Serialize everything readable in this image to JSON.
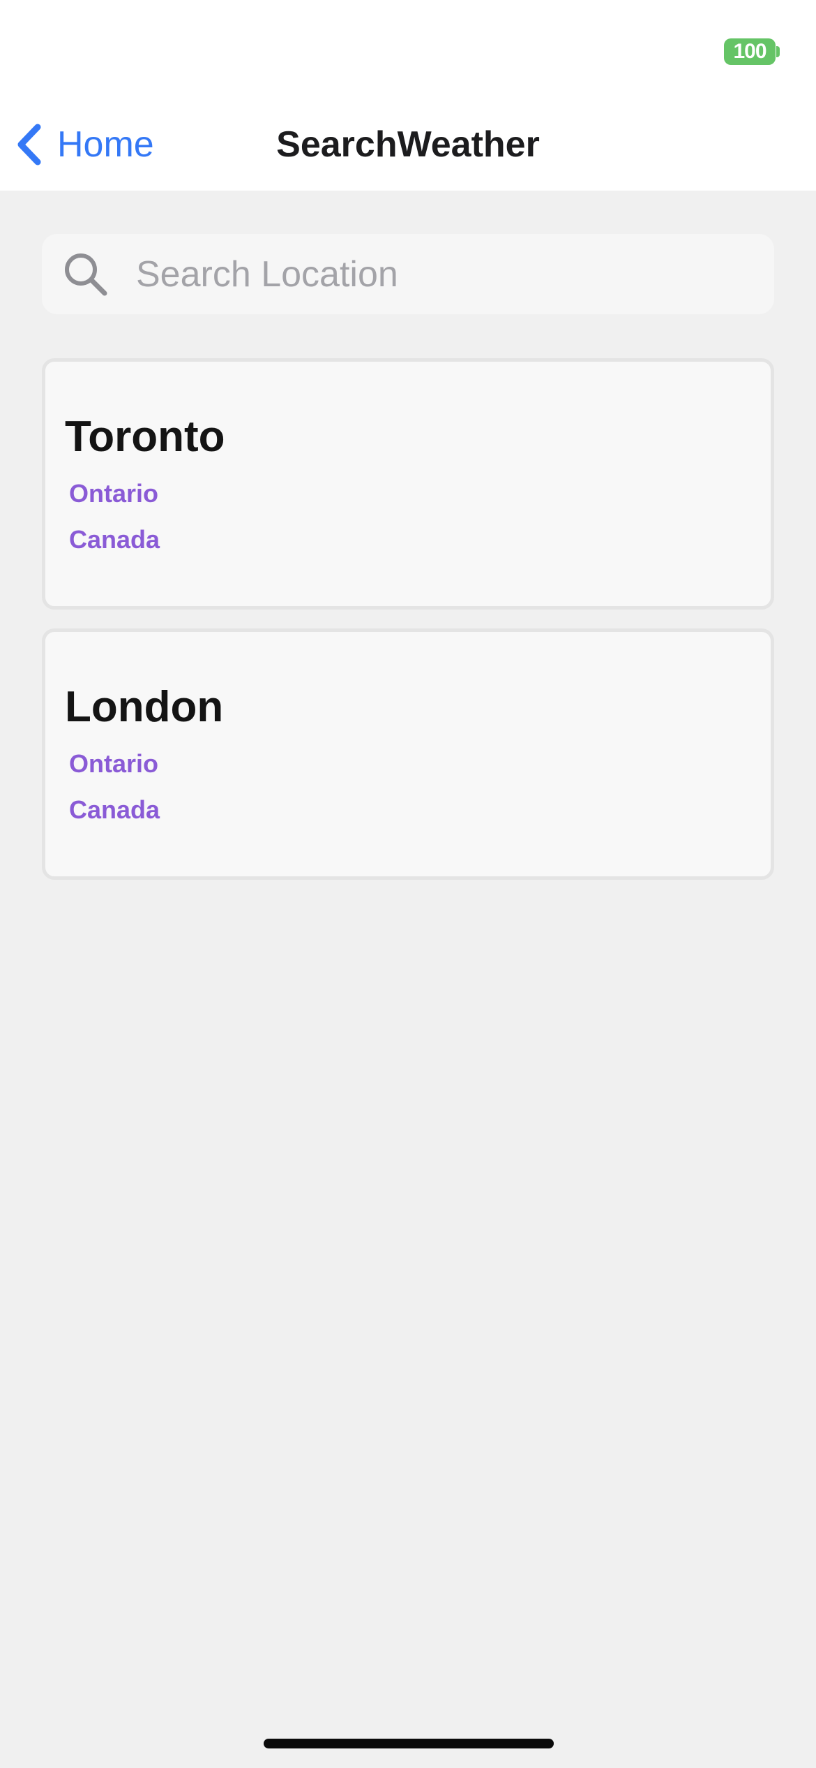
{
  "status_bar": {
    "battery_level": "100",
    "battery_color": "#65c466"
  },
  "nav": {
    "back_icon": "chevron-left-icon",
    "back_label": "Home",
    "title": "SearchWeather",
    "accent_color": "#3478f6"
  },
  "search": {
    "icon": "search-icon",
    "placeholder": "Search Location",
    "value": ""
  },
  "results": [
    {
      "city": "Toronto",
      "region": "Ontario",
      "country": "Canada"
    },
    {
      "city": "London",
      "region": "Ontario",
      "country": "Canada"
    }
  ],
  "colors": {
    "background": "#f0f0f0",
    "card_background": "#f8f8f8",
    "location_detail": "#8a5bd6"
  }
}
